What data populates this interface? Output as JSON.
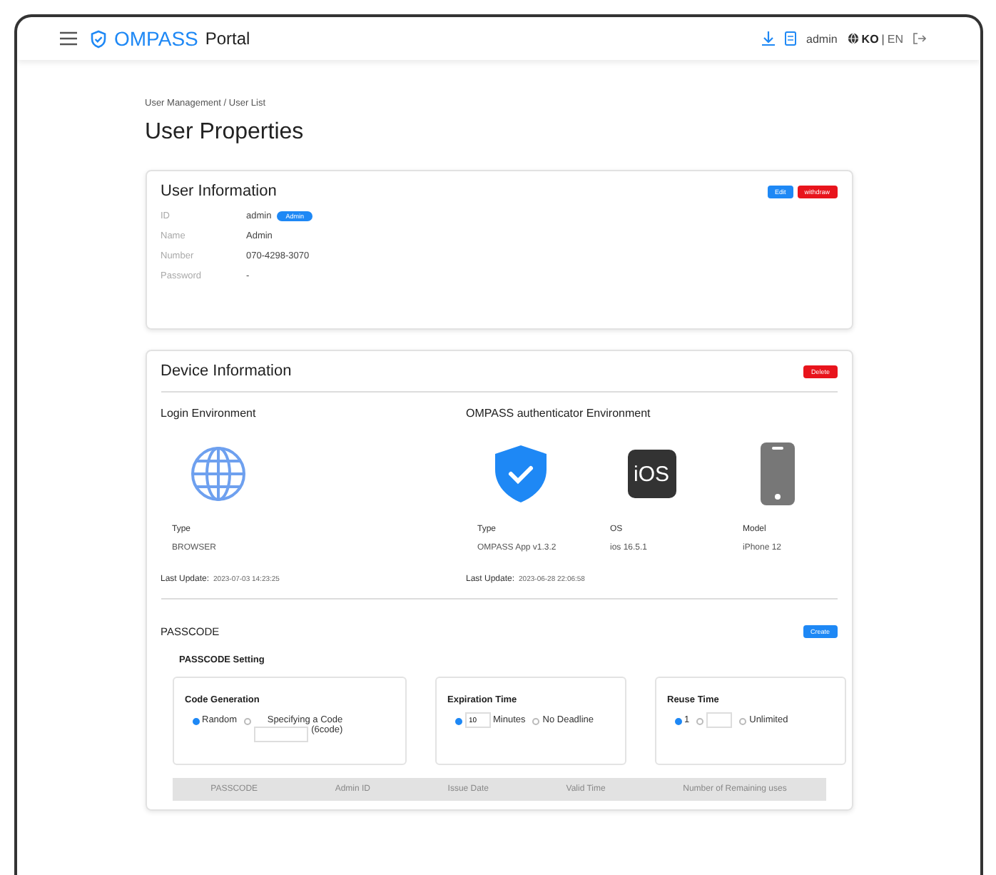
{
  "header": {
    "brand": "OMPASS",
    "brand_suffix": "Portal",
    "user": "admin",
    "languages": [
      {
        "label": "KO",
        "selected": true
      },
      {
        "label": "EN",
        "selected": false
      }
    ],
    "language_separator": "|"
  },
  "breadcrumb": "User Management / User List",
  "title": "User Properties",
  "user_info": {
    "title": "User Information",
    "buttons": [
      {
        "label": "Edit",
        "kind": "primary"
      },
      {
        "label": "withdraw",
        "kind": "danger"
      }
    ],
    "fields": [
      {
        "label": "ID",
        "value": "admin",
        "badge": "Admin"
      },
      {
        "label": "Name",
        "value": "Admin"
      },
      {
        "label": "Number",
        "value": "070-4298-3070"
      },
      {
        "label": "Password",
        "value": "-"
      }
    ]
  },
  "device_info": {
    "title": "Device Information",
    "delete_button": "Delete",
    "login_env": {
      "title": "Login Environment",
      "items": [
        {
          "kind": "globe",
          "label": "Type",
          "value": "BROWSER"
        }
      ],
      "last_update_label": "Last Update:",
      "last_update": "2023-07-03 14:23:25"
    },
    "auth_env": {
      "title": "OMPASS authenticator Environment",
      "items": [
        {
          "kind": "shield",
          "label": "Type",
          "value": "OMPASS App v1.3.2"
        },
        {
          "kind": "ios",
          "label": "OS",
          "value": "ios 16.5.1",
          "icon_text": "iOS"
        },
        {
          "kind": "phone",
          "label": "Model",
          "value": "iPhone 12"
        }
      ],
      "last_update_label": "Last Update:",
      "last_update": "2023-06-28 22:06:58"
    }
  },
  "passcode": {
    "title": "PASSCODE",
    "create_button": "Create",
    "setting_title": "PASSCODE Setting",
    "groups": [
      {
        "title": "Code Generation",
        "options": [
          {
            "kind": "label",
            "label": "Random",
            "selected": true
          },
          {
            "kind": "code",
            "label": "Specifying a Code",
            "suffix": "(6code)",
            "selected": false
          }
        ]
      },
      {
        "title": "Expiration Time",
        "options": [
          {
            "kind": "input",
            "value": "10",
            "suffix": "Minutes",
            "selected": true
          },
          {
            "kind": "label",
            "label": "No Deadline",
            "selected": false
          }
        ]
      },
      {
        "title": "Reuse Time",
        "options": [
          {
            "kind": "label",
            "label": "1",
            "selected": true
          },
          {
            "kind": "input",
            "selected": false
          },
          {
            "kind": "label",
            "label": "Unlimited",
            "selected": false
          }
        ]
      }
    ],
    "columns": [
      "PASSCODE",
      "Admin ID",
      "Issue Date",
      "Valid Time",
      "Number of Remaining uses"
    ]
  }
}
